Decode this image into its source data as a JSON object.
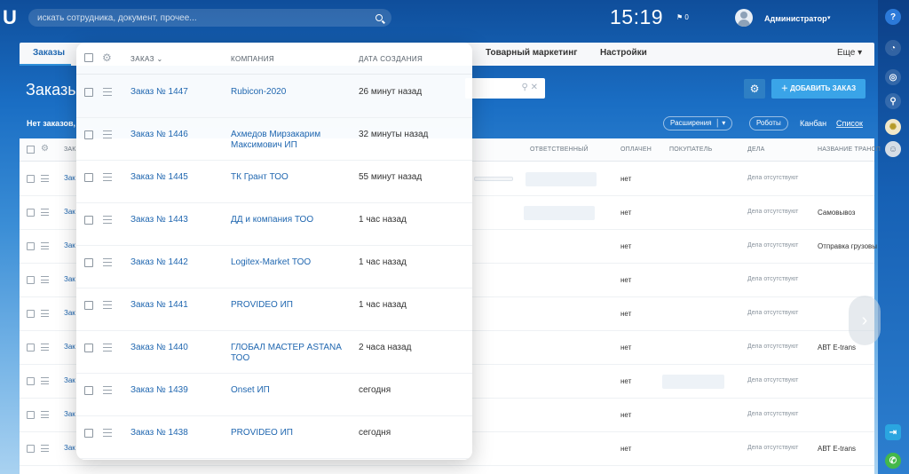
{
  "topbar": {
    "search_placeholder": "искать сотрудника, документ, прочее...",
    "clock": "15:19",
    "flag_count": "0",
    "user_name": "Администратор"
  },
  "tabs": [
    {
      "label": "Заказы",
      "active": true
    },
    {
      "label": "Товарный маркетинг",
      "active": false
    },
    {
      "label": "Настройки",
      "active": false
    }
  ],
  "more_label": "Еще",
  "page_title": "Заказы",
  "add_button": "ДОБАВИТЬ ЗАКАЗ",
  "no_orders_text": "Нет заказов,",
  "toolbar": {
    "extensions": "Расширения",
    "robots": "Роботы",
    "kanban": "Канбан",
    "list": "Список"
  },
  "bg_table": {
    "headers": {
      "order": "ЗАК",
      "responsible": "ОТВЕТСТВЕННЫЙ",
      "paid": "ОПЛАЧЕН",
      "buyer": "ПОКУПАТЕЛЬ",
      "deals": "ДЕЛА",
      "transport": "НАЗВАНИЕ ТРАНСП"
    },
    "rows": [
      {
        "order": "Зак",
        "paid": "нет",
        "deals": "Дела отсутствуют",
        "transport": ""
      },
      {
        "order": "Зак",
        "paid": "нет",
        "deals": "Дела отсутствуют",
        "transport": "Самовывоз"
      },
      {
        "order": "Зак",
        "paid": "нет",
        "deals": "Дела отсутствуют",
        "transport": "Отправка грузовы"
      },
      {
        "order": "Зак",
        "paid": "нет",
        "deals": "Дела отсутствуют",
        "transport": ""
      },
      {
        "order": "Зак",
        "paid": "нет",
        "deals": "Дела отсутствуют",
        "transport": ""
      },
      {
        "order": "Зак",
        "paid": "нет",
        "deals": "Дела отсутствуют",
        "transport": "АВТ E-trans"
      },
      {
        "order": "Зак",
        "paid": "нет",
        "deals": "Дела отсутствуют",
        "transport": ""
      },
      {
        "order": "Зак",
        "paid": "нет",
        "deals": "Дела отсутствуют",
        "transport": ""
      },
      {
        "order": "Зак",
        "paid": "нет",
        "deals": "Дела отсутствуют",
        "transport": "АВТ E-trans"
      }
    ]
  },
  "popup": {
    "headers": {
      "order": "ЗАКАЗ",
      "company": "КОМПАНИЯ",
      "date": "ДАТА СОЗДАНИЯ"
    },
    "rows": [
      {
        "order": "Заказ № 1447",
        "company": "Rubicon-2020",
        "date": "26 минут назад"
      },
      {
        "order": "Заказ № 1446",
        "company": "Ахмедов Мирзакарим Максимович ИП",
        "date": "32 минуты назад"
      },
      {
        "order": "Заказ № 1445",
        "company": "ТК Грант ТОО",
        "date": "55 минут назад"
      },
      {
        "order": "Заказ № 1443",
        "company": "ДД и компания ТОО",
        "date": "1 час назад"
      },
      {
        "order": "Заказ № 1442",
        "company": "Logitex-Market ТОО",
        "date": "1 час назад"
      },
      {
        "order": "Заказ № 1441",
        "company": "PROVIDEO ИП",
        "date": "1 час назад"
      },
      {
        "order": "Заказ № 1440",
        "company": "ГЛОБАЛ МАСТЕР ASTANA ТОО",
        "date": "2 часа назад"
      },
      {
        "order": "Заказ № 1439",
        "company": "Onset ИП",
        "date": "сегодня"
      },
      {
        "order": "Заказ № 1438",
        "company": "PROVIDEO ИП",
        "date": "сегодня"
      }
    ]
  },
  "colors": {
    "accent": "#2067b0",
    "add_button": "#3aa4e8",
    "call_button": "#44b84a"
  }
}
